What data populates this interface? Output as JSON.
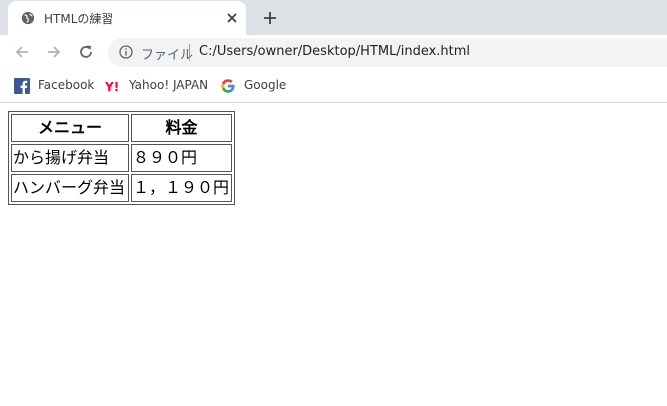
{
  "tab": {
    "title": "HTMLの練習",
    "favicon": "globe-icon"
  },
  "toolbar": {
    "scheme_label": "ファイル",
    "url": "C:/Users/owner/Desktop/HTML/index.html"
  },
  "bookmarks": [
    {
      "label": "Facebook",
      "icon": "facebook-icon"
    },
    {
      "label": "Yahoo! JAPAN",
      "icon": "yahoo-icon"
    },
    {
      "label": "Google",
      "icon": "google-icon"
    }
  ],
  "table": {
    "headers": [
      "メニュー",
      "料金"
    ],
    "rows": [
      [
        "から揚げ弁当",
        "８９０円"
      ],
      [
        "ハンバーグ弁当",
        "１，１９０円"
      ]
    ]
  },
  "colors": {
    "tabstrip": "#dee1e6",
    "omnibox": "#f1f3f4",
    "facebook": "#3b5998",
    "yahoo": "#ff0033"
  }
}
